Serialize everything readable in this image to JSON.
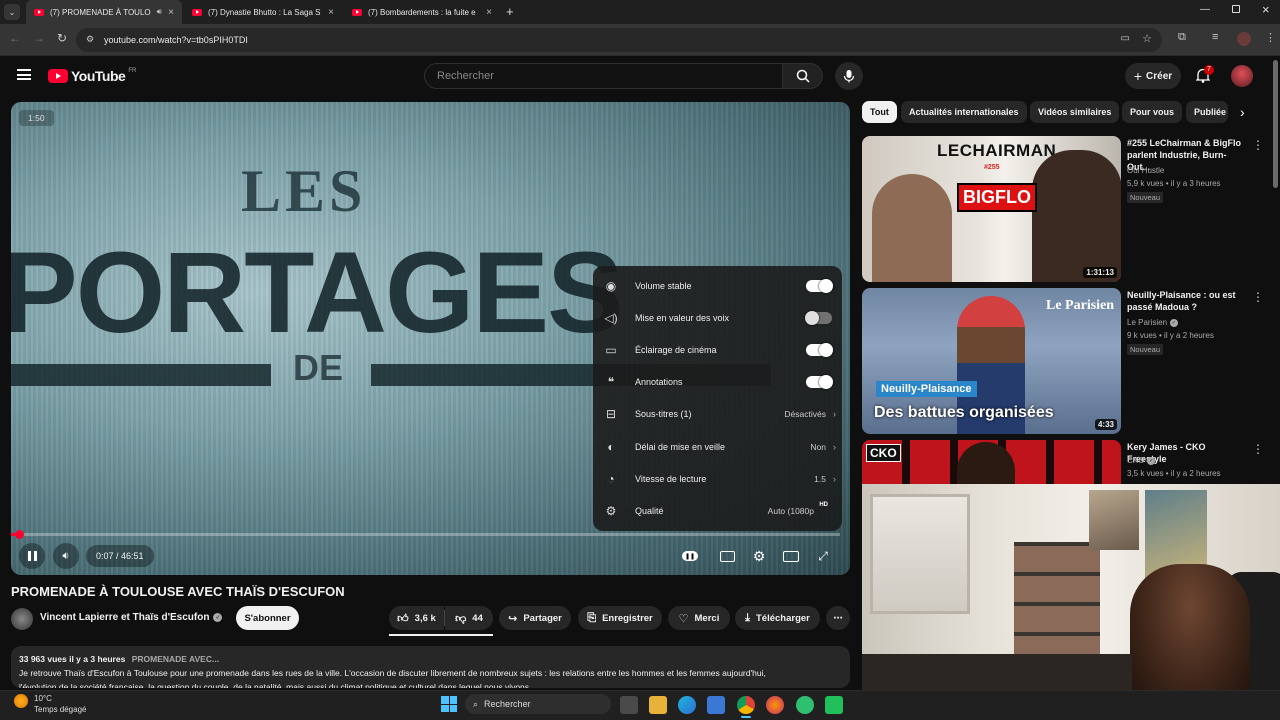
{
  "browser": {
    "tabs": [
      {
        "label": "(7) PROMENADE À TOULO",
        "active": true
      },
      {
        "label": "(7) Dynastie Bhutto : La Saga S",
        "active": false
      },
      {
        "label": "(7) Bombardements : la fuite e",
        "active": false
      }
    ],
    "url": "youtube.com/watch?v=tb0sPIH0TDI"
  },
  "youtube": {
    "logo": "YouTube",
    "region": "FR",
    "search_placeholder": "Rechercher",
    "create_label": "Créer",
    "notifications_count": "7"
  },
  "player": {
    "overlay_top": "1:50",
    "video_text_1": "LES",
    "video_text_2": "PORTAGES",
    "video_text_3": "DE",
    "time": "0:07 / 46:51",
    "progress_fraction": 0.0025,
    "settings": [
      {
        "icon": "volume-stable-icon",
        "label": "Volume stable",
        "toggle": true
      },
      {
        "icon": "voice-boost-icon",
        "label": "Mise en valeur des voix",
        "toggle": false
      },
      {
        "icon": "ambient-mode-icon",
        "label": "Éclairage de cinéma",
        "toggle": true
      },
      {
        "icon": "annotations-icon",
        "label": "Annotations",
        "toggle": true
      },
      {
        "icon": "subtitles-icon",
        "label": "Sous-titres (1)",
        "value": "Désactivés"
      },
      {
        "icon": "sleep-timer-icon",
        "label": "Délai de mise en veille",
        "value": "Non"
      },
      {
        "icon": "playback-speed-icon",
        "label": "Vitesse de lecture",
        "value": "1.5"
      },
      {
        "icon": "quality-icon",
        "label": "Qualité",
        "value": "Auto (1080p"
      }
    ]
  },
  "video": {
    "title": "PROMENADE À TOULOUSE AVEC THAÏS D'ESCUFON",
    "channel": "Vincent Lapierre et Thaïs d'Escufon",
    "subscribe": "S'abonner",
    "likes": "3,6 k",
    "dislikes": "44",
    "share": "Partager",
    "save": "Enregistrer",
    "thanks": "Merci",
    "download": "Télécharger",
    "stats": "33 963 vues  il y a 3 heures",
    "stats_tag": "PROMENADE AVEC...",
    "description_1": "Je retrouve Thaïs d'Escufon à Toulouse pour une promenade dans les rues de la ville. L'occasion de discuter librement de nombreux sujets : les relations entre les hommes et les femmes aujourd'hui,",
    "description_2": "l'évolution de la société française, la question du couple, de la natalité, mais aussi du climat politique et culturel dans lequel nous vivons..."
  },
  "sidebar": {
    "chips": [
      "Tout",
      "Actualités internationales",
      "Vidéos similaires",
      "Pour vous",
      "Publiée"
    ],
    "videos": [
      {
        "title": "#255 LeChairman & BigFlo parlent Industrie, Burn-Out...",
        "channel": "Oui Hustle",
        "meta": "5,9 k vues • il y a 3 heures",
        "badge": "Nouveau",
        "duration": "1:31:13",
        "thumb_text_1": "LECHAIRMAN",
        "thumb_text_2": "#255",
        "thumb_text_3": "BIGFLO"
      },
      {
        "title": "Neuilly-Plaisance : ou est passé Madoua ?",
        "channel": "Le Parisien",
        "meta": "9 k vues • il y a 2 heures",
        "badge": "Nouveau",
        "duration": "4:33",
        "thumb_text_1": "Le Parisien",
        "thumb_text_2": "Neuilly-Plaisance",
        "thumb_text_3": "Des battues organisées"
      },
      {
        "title": "Kery James - CKO Freestyle",
        "channel": "CKO",
        "meta": "3,5 k vues • il y a 2 heures",
        "badge": "",
        "duration": "",
        "thumb_text_1": "CKO"
      }
    ]
  },
  "taskbar": {
    "temperature": "10°C",
    "weather": "Temps dégagé",
    "search": "Rechercher"
  }
}
